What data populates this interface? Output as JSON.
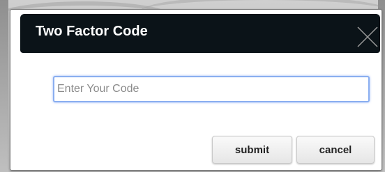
{
  "dialog": {
    "title": "Two Factor Code",
    "close_icon": "close-icon",
    "code_input": {
      "value": "",
      "placeholder": "Enter Your Code"
    },
    "submit_label": "submit",
    "cancel_label": "cancel"
  },
  "colors": {
    "header_bg": "#0b1318",
    "header_text": "#ffffff",
    "input_focus_border": "#8aaef0",
    "button_bg": "#eeeeee"
  }
}
